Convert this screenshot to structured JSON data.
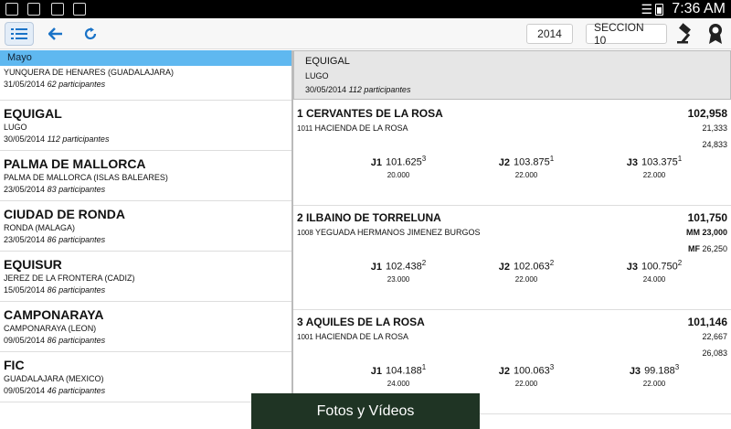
{
  "status_bar": {
    "time": "7:36 AM"
  },
  "toolbar": {
    "year": "2014",
    "section": "SECCION 10"
  },
  "left_panel": {
    "month": "Mayo",
    "competitions": [
      {
        "name": "EQUIGAL",
        "location": "LUGO",
        "date": "30/05/2014",
        "participants": "112 participantes"
      },
      {
        "name": "PALMA DE MALLORCA",
        "location": "PALMA DE MALLORCA (ISLAS BALEARES)",
        "date": "23/05/2014",
        "participants": "83 participantes"
      },
      {
        "name": "CIUDAD DE RONDA",
        "location": "RONDA (MALAGA)",
        "date": "23/05/2014",
        "participants": "86 participantes"
      },
      {
        "name": "EQUISUR",
        "location": "JEREZ DE LA FRONTERA (CADIZ)",
        "date": "15/05/2014",
        "participants": "86 participantes"
      },
      {
        "name": "CAMPONARAYA",
        "location": "CAMPONARAYA (LEON)",
        "date": "09/05/2014",
        "participants": "86 participantes"
      },
      {
        "name": "FIC",
        "location": "GUADALAJARA (MEXICO)",
        "date": "09/05/2014",
        "participants": "46 participantes"
      }
    ],
    "partial_top": {
      "location": "YUNQUERA DE HENARES (GUADALAJARA)",
      "date": "31/05/2014",
      "participants": "62 participantes"
    }
  },
  "detail": {
    "event": {
      "name": "EQUIGAL",
      "location": "LUGO",
      "date": "30/05/2014",
      "participants": "112 participantes"
    },
    "results": [
      {
        "title": "1 CERVANTES DE LA ROSA",
        "score": "102,958",
        "id": "1011",
        "owner": "HACIENDA DE LA ROSA",
        "sub1": "21,333",
        "sub2_label": "",
        "sub2": "24,833",
        "judges": [
          {
            "label": "J1",
            "value": "101.625",
            "rank": "3",
            "sub": "20.000"
          },
          {
            "label": "J2",
            "value": "103.875",
            "rank": "1",
            "sub": "22.000"
          },
          {
            "label": "J3",
            "value": "103.375",
            "rank": "1",
            "sub": "22.000"
          }
        ]
      },
      {
        "title": "2 ILBAINO DE TORRELUNA",
        "score": "101,750",
        "id": "1008",
        "owner": "YEGUADA HERMANOS JIMENEZ BURGOS",
        "sub1": "MM 23,000",
        "sub2_label": "MF",
        "sub2": "26,250",
        "judges": [
          {
            "label": "J1",
            "value": "102.438",
            "rank": "2",
            "sub": "23.000"
          },
          {
            "label": "J2",
            "value": "102.063",
            "rank": "2",
            "sub": "22.000"
          },
          {
            "label": "J3",
            "value": "100.750",
            "rank": "2",
            "sub": "24.000"
          }
        ]
      },
      {
        "title": "3 AQUILES DE LA ROSA",
        "score": "101,146",
        "id": "1001",
        "owner": "HACIENDA DE LA ROSA",
        "sub1": "22,667",
        "sub2_label": "",
        "sub2": "26,083",
        "judges": [
          {
            "label": "J1",
            "value": "104.188",
            "rank": "1",
            "sub": "24.000"
          },
          {
            "label": "J2",
            "value": "100.063",
            "rank": "3",
            "sub": "22.000"
          },
          {
            "label": "J3",
            "value": "99.188",
            "rank": "3",
            "sub": "22.000"
          }
        ]
      }
    ]
  },
  "footer": {
    "button_label": "Fotos y Vídeos"
  }
}
